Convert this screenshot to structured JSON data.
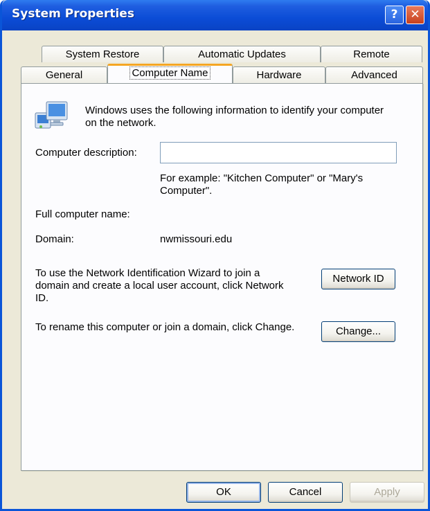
{
  "window": {
    "title": "System Properties",
    "help_glyph": "?",
    "close_glyph": "✕"
  },
  "tabs_back": [
    "System Restore",
    "Automatic Updates",
    "Remote"
  ],
  "tabs_front": [
    "General",
    "Computer Name",
    "Hardware",
    "Advanced"
  ],
  "active_tab": "Computer Name",
  "panel": {
    "intro_line1": "Windows uses the following information to identify your computer",
    "intro_line2": "on the network.",
    "description_label": "Computer description:",
    "description_value": "",
    "example_line1": "For example: \"Kitchen Computer\" or \"Mary's",
    "example_line2": "Computer\".",
    "full_name_label": "Full computer name:",
    "full_name_value": "",
    "domain_label": "Domain:",
    "domain_value": "nwmissouri.edu",
    "network_text_line1": "To use the Network Identification Wizard to join a",
    "network_text_line2": "domain and create a local user account, click Network",
    "network_text_line3": "ID.",
    "network_button": "Network ID",
    "rename_text": "To rename this computer or join a domain, click Change.",
    "change_button": "Change..."
  },
  "footer": {
    "ok": "OK",
    "cancel": "Cancel",
    "apply": "Apply"
  },
  "icon": "computer-network-icon"
}
